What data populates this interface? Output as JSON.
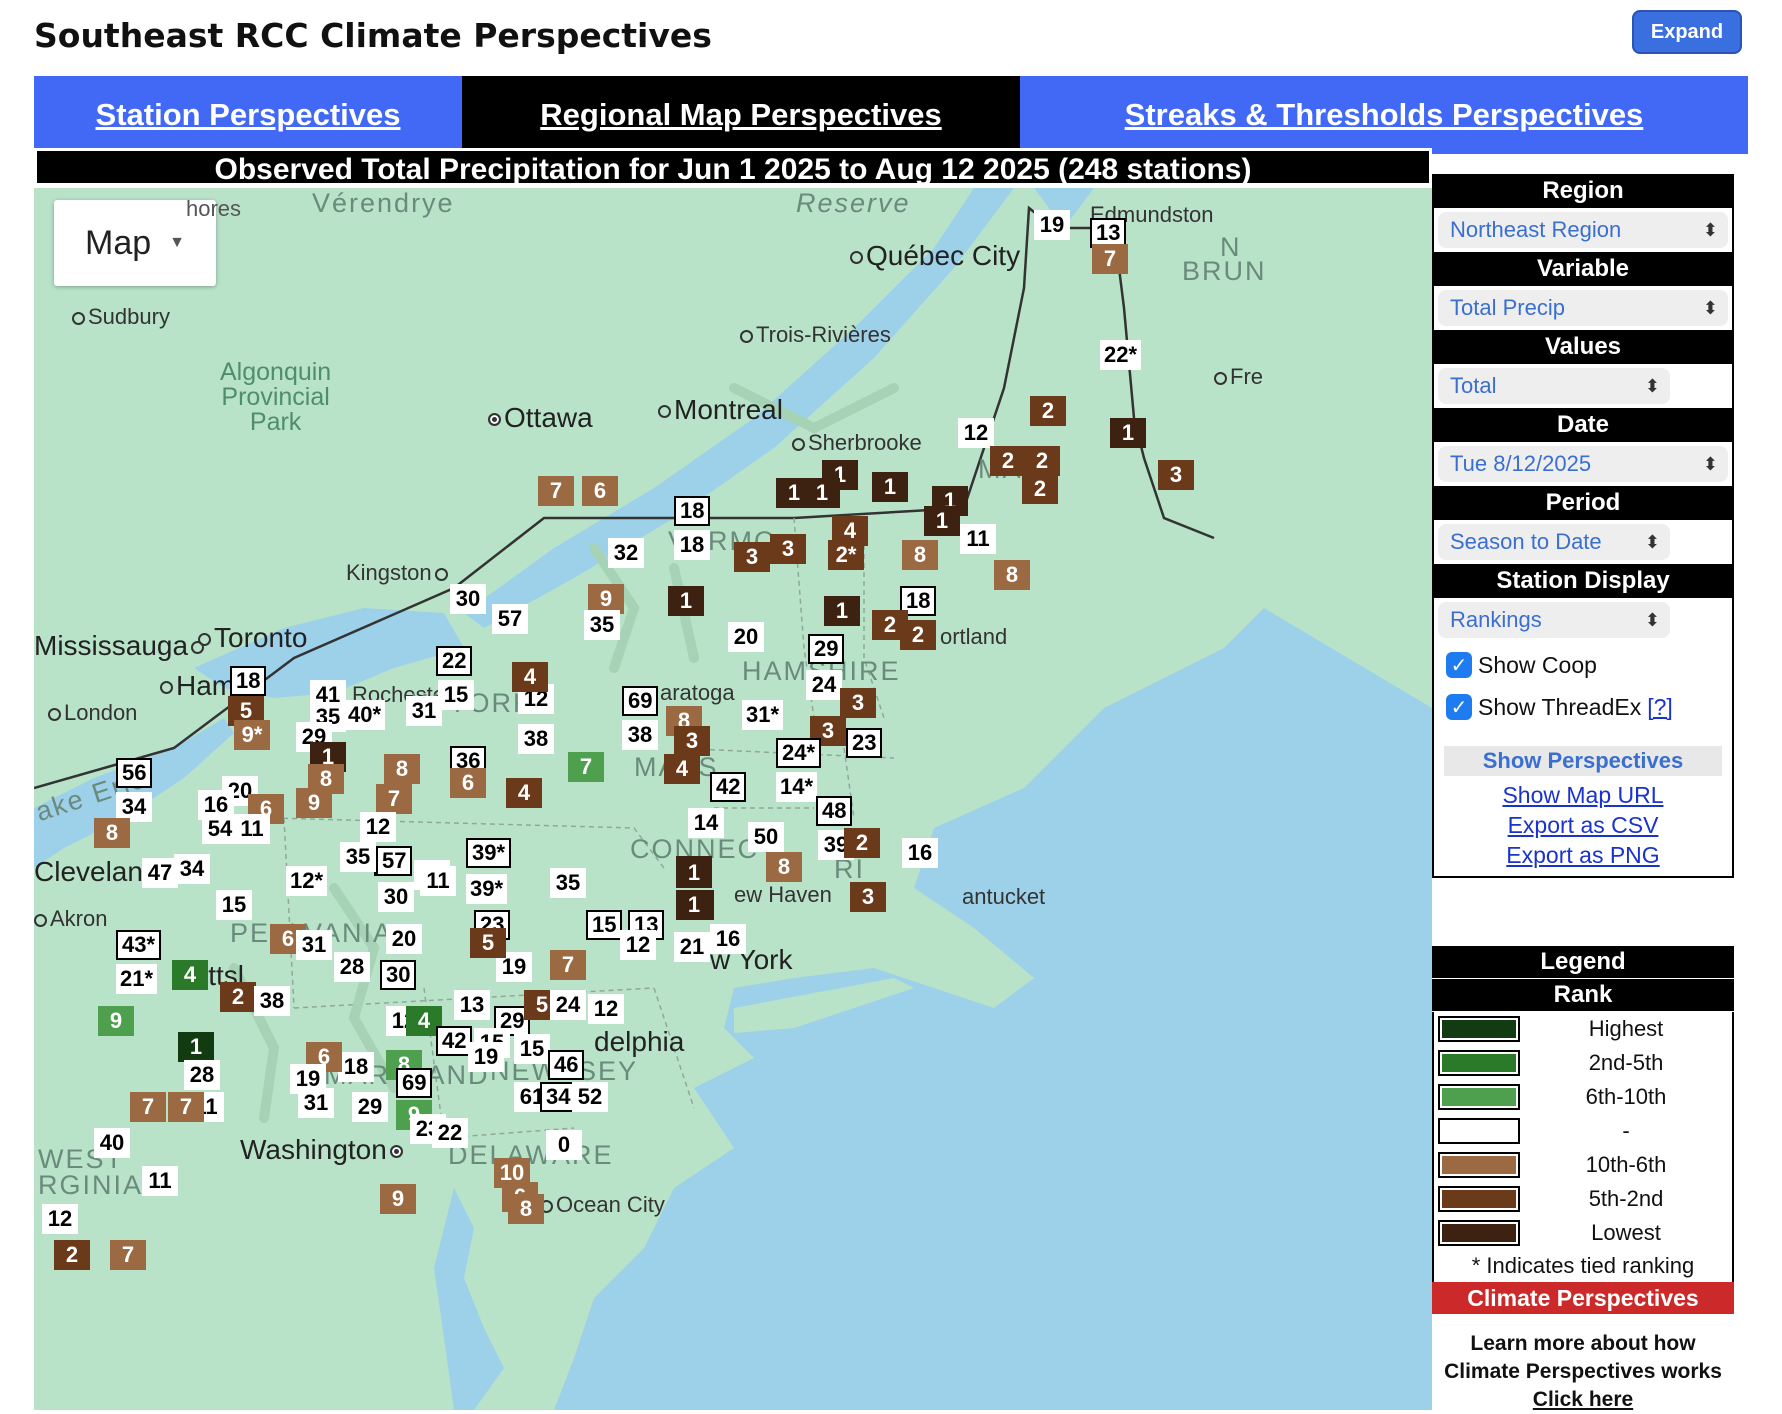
{
  "header": {
    "title": "Southeast RCC Climate Perspectives",
    "expand_label": "Expand"
  },
  "tabs": [
    "Station Perspectives",
    "Regional Map Perspectives",
    "Streaks & Thresholds Perspectives"
  ],
  "map": {
    "title": "Observed Total Precipitation for Jun 1 2025 to Aug 12 2025 (248 stations)",
    "type_control": "Map",
    "places": {
      "quebec": "Québec City",
      "trois": "Trois-Rivières",
      "montreal": "Montreal",
      "ottawa": "Ottawa",
      "sherbrooke": "Sherbrooke",
      "sudbury": "Sudbury",
      "kingston": "Kingston",
      "toronto": "Toronto",
      "mississauga": "Mississauga",
      "hamilton": "Ham",
      "london": "London",
      "cleveland": "Cleveland",
      "akron": "Akron",
      "pitt": "ittsl",
      "washington": "Washington",
      "philly": "delphia",
      "newhaven": "ew Haven",
      "newyork": "w York",
      "nantucket": "antucket",
      "portland": "ortland",
      "edmundston": "Edmundston",
      "fre": "Fre",
      "oceancity": "Ocean City",
      "saratoga": "aratoga",
      "rochester": "Rochester",
      "verendrye": "Vérendrye",
      "reserve": "Reserve",
      "shores": "hores",
      "algonquin": "Algonquin\nProvincial\nPark",
      "lake_erie": "ake Erie",
      "brun": "BRUN",
      "n_brun": "N",
      "ny_state": "W YORK",
      "ma_state": "MASS",
      "ma_short": "MA",
      "conn": "CONNECT",
      "ri": "RI",
      "vt": "VERMO",
      "nh": "HAMSHIRE",
      "pa": "PE  LVANIA",
      "md": "MARYLAND",
      "nj": "NEW  SEY",
      "de": "DELAWARE",
      "wv": "WEST\nRGINIA"
    }
  },
  "stations": [
    {
      "v": "19",
      "s": "w"
    },
    {
      "v": "13",
      "s": "wb"
    },
    {
      "v": "7",
      "s": "t"
    },
    {
      "v": "22*",
      "s": "w"
    },
    {
      "v": "2",
      "s": "b"
    },
    {
      "v": "1",
      "s": "d"
    },
    {
      "v": "3",
      "s": "b"
    },
    {
      "v": "12",
      "s": "w"
    },
    {
      "v": "2",
      "s": "b"
    },
    {
      "v": "2",
      "s": "b"
    },
    {
      "v": "2",
      "s": "b"
    },
    {
      "v": "1",
      "s": "d"
    },
    {
      "v": "1",
      "s": "d"
    },
    {
      "v": "1",
      "s": "d"
    },
    {
      "v": "11",
      "s": "w"
    },
    {
      "v": "1",
      "s": "d"
    },
    {
      "v": "1",
      "s": "d"
    },
    {
      "v": "1",
      "s": "d"
    },
    {
      "v": "4",
      "s": "b"
    },
    {
      "v": "8",
      "s": "t"
    },
    {
      "v": "8",
      "s": "t"
    },
    {
      "v": "3",
      "s": "b"
    },
    {
      "v": "3",
      "s": "b"
    },
    {
      "v": "2*",
      "s": "b"
    },
    {
      "v": "18",
      "s": "wb"
    },
    {
      "v": "18",
      "s": "w"
    },
    {
      "v": "7",
      "s": "t"
    },
    {
      "v": "6",
      "s": "t"
    },
    {
      "v": "32",
      "s": "w"
    },
    {
      "v": "9",
      "s": "t"
    },
    {
      "v": "35",
      "s": "w"
    },
    {
      "v": "1",
      "s": "d"
    },
    {
      "v": "1",
      "s": "d"
    },
    {
      "v": "18",
      "s": "wb"
    },
    {
      "v": "2",
      "s": "b"
    },
    {
      "v": "2",
      "s": "b"
    },
    {
      "v": "12",
      "s": "w"
    },
    {
      "v": "30",
      "s": "w"
    },
    {
      "v": "57",
      "s": "w"
    },
    {
      "v": "20",
      "s": "w"
    },
    {
      "v": "29",
      "s": "wb"
    },
    {
      "v": "24",
      "s": "w"
    },
    {
      "v": "4",
      "s": "b"
    },
    {
      "v": "69",
      "s": "wb"
    },
    {
      "v": "8",
      "s": "t"
    },
    {
      "v": "31*",
      "s": "w"
    },
    {
      "v": "3",
      "s": "b"
    },
    {
      "v": "38",
      "s": "w"
    },
    {
      "v": "3",
      "s": "b"
    },
    {
      "v": "3",
      "s": "b"
    },
    {
      "v": "23",
      "s": "wb"
    },
    {
      "v": "4",
      "s": "b"
    },
    {
      "v": "7",
      "s": "g"
    },
    {
      "v": "24*",
      "s": "wb"
    },
    {
      "v": "42",
      "s": "wb"
    },
    {
      "v": "14*",
      "s": "w"
    },
    {
      "v": "48",
      "s": "wb"
    },
    {
      "v": "14",
      "s": "w"
    },
    {
      "v": "50",
      "s": "w"
    },
    {
      "v": "39",
      "s": "w"
    },
    {
      "v": "2",
      "s": "b"
    },
    {
      "v": "16",
      "s": "w"
    },
    {
      "v": "8",
      "s": "t"
    },
    {
      "v": "1",
      "s": "d"
    },
    {
      "v": "1",
      "s": "d"
    },
    {
      "v": "3",
      "s": "b"
    },
    {
      "v": "57",
      "s": "wb"
    },
    {
      "v": "22",
      "s": "wb"
    },
    {
      "v": "15",
      "s": "w"
    },
    {
      "v": "4",
      "s": "b"
    },
    {
      "v": "18",
      "s": "wb"
    },
    {
      "v": "41",
      "s": "w"
    },
    {
      "v": "35",
      "s": "w"
    },
    {
      "v": "40*",
      "s": "w"
    },
    {
      "v": "31",
      "s": "w"
    },
    {
      "v": "5",
      "s": "b"
    },
    {
      "v": "9*",
      "s": "t"
    },
    {
      "v": "29",
      "s": "w"
    },
    {
      "v": "1",
      "s": "d"
    },
    {
      "v": "38",
      "s": "w"
    },
    {
      "v": "36",
      "s": "wb"
    },
    {
      "v": "8",
      "s": "t"
    },
    {
      "v": "8",
      "s": "t"
    },
    {
      "v": "6",
      "s": "t"
    },
    {
      "v": "4",
      "s": "b"
    },
    {
      "v": "56",
      "s": "wb"
    },
    {
      "v": "34",
      "s": "w"
    },
    {
      "v": "20",
      "s": "w"
    },
    {
      "v": "16",
      "s": "w"
    },
    {
      "v": "6",
      "s": "t"
    },
    {
      "v": "9",
      "s": "t"
    },
    {
      "v": "7",
      "s": "t"
    },
    {
      "v": "8",
      "s": "t"
    },
    {
      "v": "54",
      "s": "w"
    },
    {
      "v": "11",
      "s": "w"
    },
    {
      "v": "12",
      "s": "w"
    },
    {
      "v": "35",
      "s": "w"
    },
    {
      "v": "57",
      "s": "wb"
    },
    {
      "v": "11",
      "s": "w"
    },
    {
      "v": "39*",
      "s": "wb"
    },
    {
      "v": "39*",
      "s": "w"
    },
    {
      "v": "35",
      "s": "w"
    },
    {
      "v": "11",
      "s": "w"
    },
    {
      "v": "47",
      "s": "w"
    },
    {
      "v": "34",
      "s": "w"
    },
    {
      "v": "12*",
      "s": "w"
    },
    {
      "v": "30",
      "s": "w"
    },
    {
      "v": "15",
      "s": "w"
    },
    {
      "v": "43*",
      "s": "wb"
    },
    {
      "v": "6",
      "s": "t"
    },
    {
      "v": "31",
      "s": "w"
    },
    {
      "v": "20",
      "s": "w"
    },
    {
      "v": "28",
      "s": "w"
    },
    {
      "v": "23",
      "s": "wb"
    },
    {
      "v": "19",
      "s": "w"
    },
    {
      "v": "5",
      "s": "b"
    },
    {
      "v": "7",
      "s": "t"
    },
    {
      "v": "15",
      "s": "wb"
    },
    {
      "v": "13",
      "s": "wb"
    },
    {
      "v": "12",
      "s": "w"
    },
    {
      "v": "21",
      "s": "w"
    },
    {
      "v": "16",
      "s": "w"
    },
    {
      "v": "1",
      "s": "d"
    },
    {
      "v": "1",
      "s": "d"
    },
    {
      "v": "21*",
      "s": "w"
    },
    {
      "v": "4",
      "s": "g2"
    },
    {
      "v": "30",
      "s": "wb"
    },
    {
      "v": "2",
      "s": "b"
    },
    {
      "v": "38",
      "s": "w"
    },
    {
      "v": "12",
      "s": "w"
    },
    {
      "v": "13",
      "s": "w"
    },
    {
      "v": "29",
      "s": "wb"
    },
    {
      "v": "5",
      "s": "b"
    },
    {
      "v": "24",
      "s": "w"
    },
    {
      "v": "12",
      "s": "w"
    },
    {
      "v": "15",
      "s": "w"
    },
    {
      "v": "9",
      "s": "g"
    },
    {
      "v": "1",
      "s": "g3"
    },
    {
      "v": "4",
      "s": "g2"
    },
    {
      "v": "42",
      "s": "wb"
    },
    {
      "v": "15",
      "s": "w"
    },
    {
      "v": "46",
      "s": "wb"
    },
    {
      "v": "18",
      "s": "w"
    },
    {
      "v": "6",
      "s": "t"
    },
    {
      "v": "8",
      "s": "g"
    },
    {
      "v": "28",
      "s": "w"
    },
    {
      "v": "11",
      "s": "w"
    },
    {
      "v": "19",
      "s": "w"
    },
    {
      "v": "19",
      "s": "w"
    },
    {
      "v": "69",
      "s": "wb"
    },
    {
      "v": "31",
      "s": "w"
    },
    {
      "v": "0",
      "s": "w"
    },
    {
      "v": "61",
      "s": "w"
    },
    {
      "v": "34",
      "s": "wb"
    },
    {
      "v": "52",
      "s": "w"
    },
    {
      "v": "7",
      "s": "t"
    },
    {
      "v": "7",
      "s": "t"
    },
    {
      "v": "40",
      "s": "w"
    },
    {
      "v": "29",
      "s": "w"
    },
    {
      "v": "9",
      "s": "g"
    },
    {
      "v": "11",
      "s": "w"
    },
    {
      "v": "23",
      "s": "w"
    },
    {
      "v": "22",
      "s": "w"
    },
    {
      "v": "10",
      "s": "t"
    },
    {
      "v": "6",
      "s": "t"
    },
    {
      "v": "9",
      "s": "t"
    },
    {
      "v": "8",
      "s": "t"
    },
    {
      "v": "12",
      "s": "w"
    },
    {
      "v": "2",
      "s": "b"
    },
    {
      "v": "7",
      "s": "t"
    }
  ],
  "panel": {
    "region_label": "Region",
    "region_value": "Northeast Region",
    "variable_label": "Variable",
    "variable_value": "Total Precip",
    "values_label": "Values",
    "values_value": "Total",
    "date_label": "Date",
    "date_value": "Tue 8/12/2025",
    "period_label": "Period",
    "period_value": "Season to Date",
    "display_label": "Station Display",
    "display_value": "Rankings",
    "show_coop": "Show Coop",
    "show_threadex": "Show ThreadEx",
    "help": "[?]",
    "show_perspectives": "Show Perspectives",
    "links": [
      "Show Map URL",
      "Export as CSV",
      "Export as PNG"
    ]
  },
  "legend": {
    "title": "Legend",
    "subtitle": "Rank",
    "items": [
      {
        "label": "Highest",
        "color": "#123b12"
      },
      {
        "label": "2nd-5th",
        "color": "#2a7a2a"
      },
      {
        "label": "6th-10th",
        "color": "#4ea04e"
      },
      {
        "label": "-",
        "color": "#ffffff"
      },
      {
        "label": "10th-6th",
        "color": "#9b6a43"
      },
      {
        "label": "5th-2nd",
        "color": "#6b3a1a"
      },
      {
        "label": "Lowest",
        "color": "#3d2211"
      }
    ],
    "note": "* Indicates tied ranking",
    "cp_bar": "Climate Perspectives",
    "learn_line1": "Learn more about how",
    "learn_line2": "Climate Perspectives works",
    "click_here": "Click here"
  }
}
